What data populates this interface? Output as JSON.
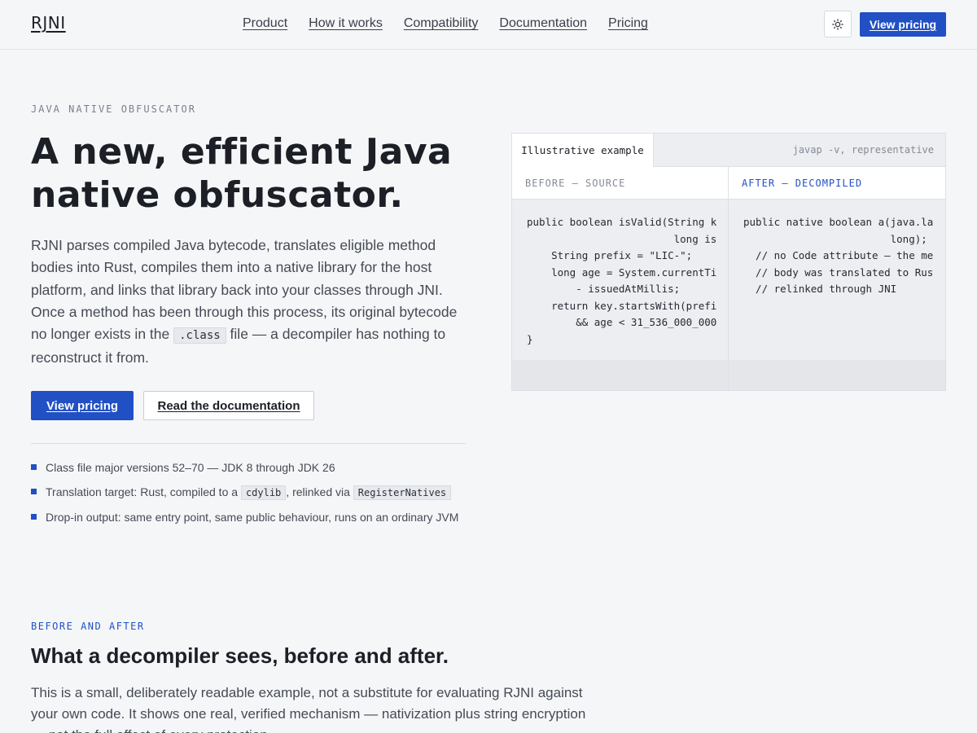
{
  "header": {
    "logo": "RJNI",
    "nav": [
      "Product",
      "How it works",
      "Compatibility",
      "Documentation",
      "Pricing"
    ],
    "theme_icon": "sun-icon",
    "cta_label": "View pricing"
  },
  "hero": {
    "eyebrow": "JAVA NATIVE OBFUSCATOR",
    "title": "A new, efficient Java native obfuscator.",
    "desc_before": "RJNI parses compiled Java bytecode, translates eligible method bodies into Rust, compiles them into a native library for the host platform, and links that library back into your classes through JNI. Once a method has been through this process, its original bytecode no longer exists in the ",
    "desc_code": ".class",
    "desc_after": " file — a decompiler has nothing to reconstruct it from.",
    "primary_button": "View pricing",
    "secondary_button": "Read the documentation",
    "features": [
      {
        "text_before": "Class file major versions 52–70 — JDK 8 through JDK 26",
        "code1": "",
        "text_mid": "",
        "code2": "",
        "text_after": ""
      },
      {
        "text_before": "Translation target: Rust, compiled to a ",
        "code1": "cdylib",
        "text_mid": ", relinked via ",
        "code2": "RegisterNatives",
        "text_after": ""
      },
      {
        "text_before": "Drop-in output: same entry point, same public behaviour, runs on an ordinary JVM",
        "code1": "",
        "text_mid": "",
        "code2": "",
        "text_after": ""
      }
    ]
  },
  "panel": {
    "tab_label": "Illustrative example",
    "note": "javap -v, representative",
    "before_heading": "BEFORE — SOURCE",
    "after_heading": "AFTER — DECOMPILED",
    "before_code": [
      "public boolean isValid(String k",
      "                        long is",
      "    String prefix = \"LIC-\";",
      "    long age = System.currentTi",
      "        - issuedAtMillis;",
      "    return key.startsWith(prefi",
      "        && age < 31_536_000_000",
      "}"
    ],
    "after_code": [
      "public native boolean a(java.la",
      "                        long);",
      "  // no Code attribute — the me",
      "  // body was translated to Rus",
      "  // relinked through JNI"
    ]
  },
  "section2": {
    "eyebrow": "BEFORE AND AFTER",
    "title": "What a decompiler sees, before and after.",
    "desc": "This is a small, deliberately readable example, not a substitute for evaluating RJNI against your own code. It shows one real, verified mechanism — nativization plus string encryption — not the full effect of every protection."
  },
  "colors": {
    "accent": "#2150c5",
    "background": "#f5f6f8",
    "text": "#1c1f26"
  }
}
